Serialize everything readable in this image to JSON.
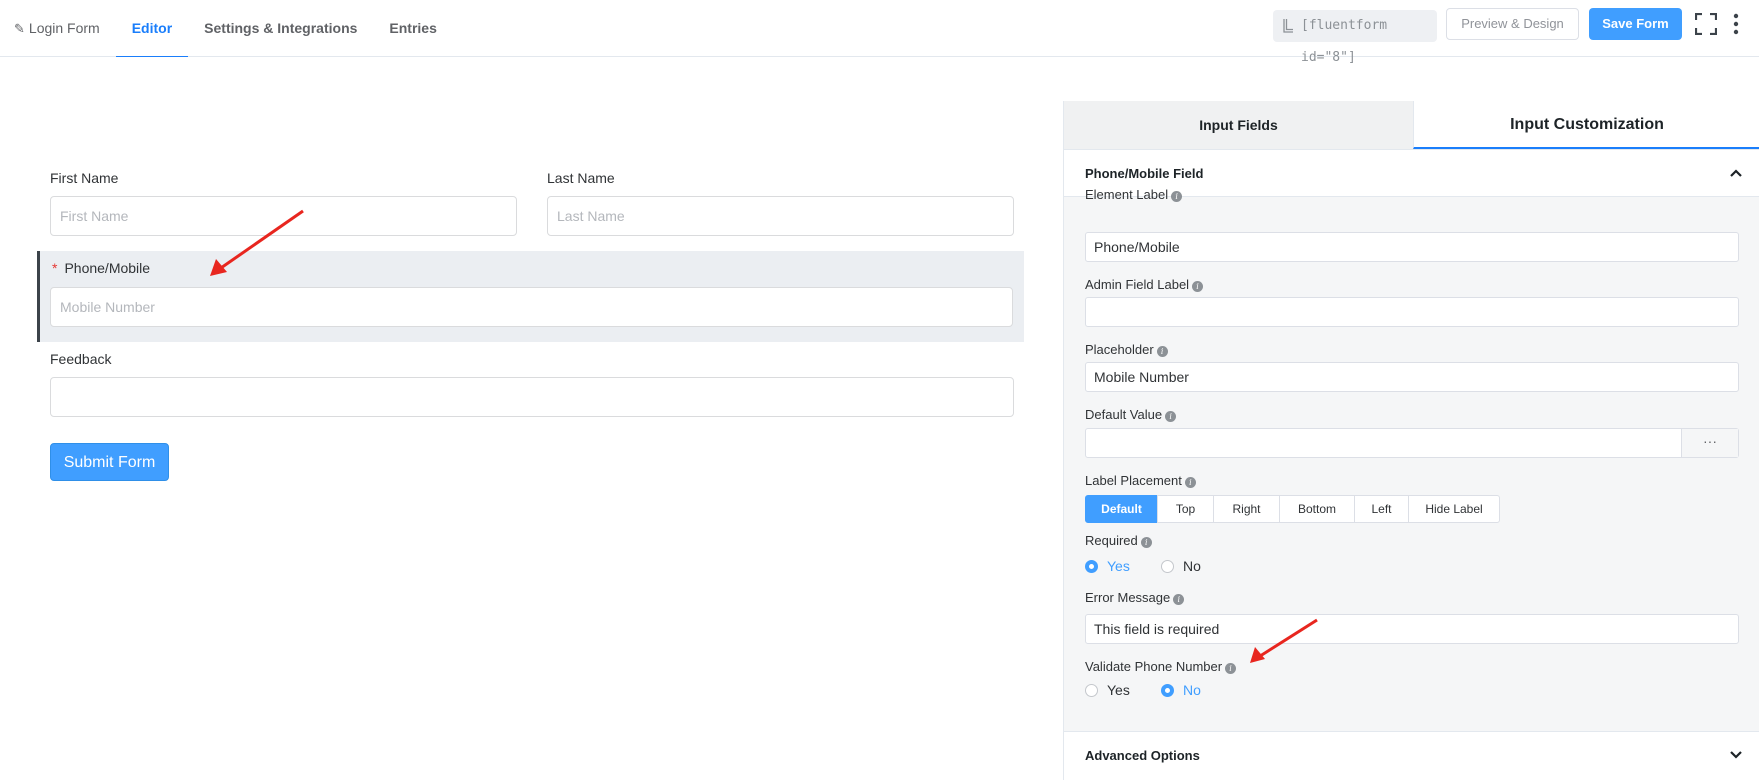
{
  "tabs": {
    "login_form": "Login Form",
    "editor": "Editor",
    "settings": "Settings & Integrations",
    "entries": "Entries"
  },
  "toolbar": {
    "shortcode": "[fluentform id=\"8\"]",
    "preview_label": "Preview & Design",
    "save_label": "Save Form"
  },
  "form": {
    "first_name": {
      "label": "First Name",
      "placeholder": "First Name"
    },
    "last_name": {
      "label": "Last Name",
      "placeholder": "Last Name"
    },
    "phone": {
      "label": "Phone/Mobile",
      "required_mark": "*",
      "placeholder": "Mobile Number"
    },
    "feedback": {
      "label": "Feedback",
      "placeholder": ""
    },
    "submit_label": "Submit Form"
  },
  "panel": {
    "tab_fields": "Input Fields",
    "tab_customization": "Input Customization",
    "section_title": "Phone/Mobile Field",
    "element_label": {
      "label": "Element Label",
      "value": "Phone/Mobile"
    },
    "admin_label": {
      "label": "Admin Field Label",
      "value": ""
    },
    "placeholder": {
      "label": "Placeholder",
      "value": "Mobile Number"
    },
    "default_value": {
      "label": "Default Value",
      "value": "",
      "dots": "···"
    },
    "label_placement": {
      "label": "Label Placement",
      "options": [
        "Default",
        "Top",
        "Right",
        "Bottom",
        "Left",
        "Hide Label"
      ],
      "selected": "Default"
    },
    "required": {
      "label": "Required",
      "yes": "Yes",
      "no": "No",
      "selected": "Yes"
    },
    "error_message": {
      "label": "Error Message",
      "value": "This field is required"
    },
    "validate_phone": {
      "label": "Validate Phone Number",
      "yes": "Yes",
      "no": "No",
      "selected": "No"
    },
    "advanced_options": "Advanced Options"
  },
  "colors": {
    "accent": "#409eff",
    "active_tab": "#1a7efb",
    "annotation_arrow": "#e8261f",
    "required_star": "#e53935"
  }
}
